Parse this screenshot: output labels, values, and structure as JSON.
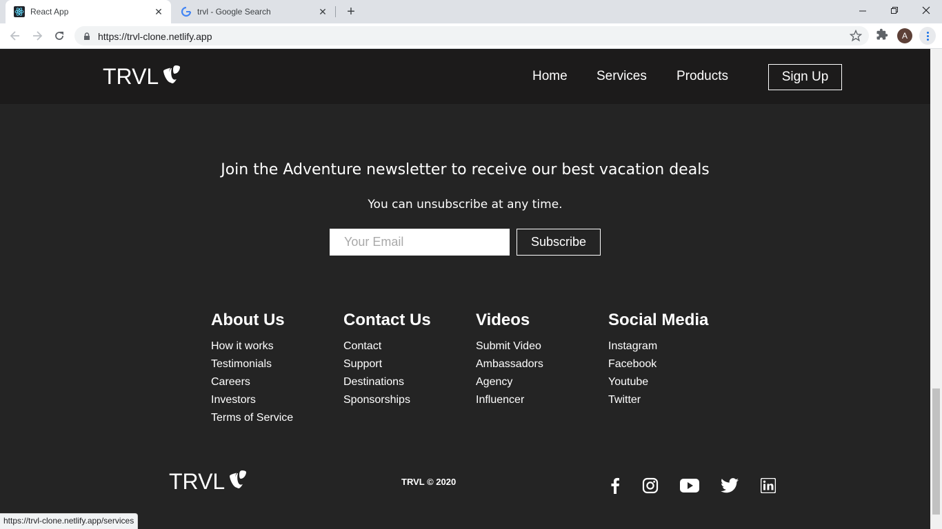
{
  "browser": {
    "tabs": [
      {
        "title": "React App",
        "favicon": "react-icon"
      },
      {
        "title": "trvl - Google Search",
        "favicon": "google-icon"
      }
    ],
    "url": "https://trvl-clone.netlify.app",
    "status_url": "https://trvl-clone.netlify.app/services",
    "profile_initial": "A"
  },
  "navbar": {
    "logo": "TRVL",
    "links": [
      "Home",
      "Services",
      "Products"
    ],
    "signup": "Sign Up"
  },
  "newsletter": {
    "heading": "Join the Adventure newsletter to receive our best vacation deals",
    "subheading": "You can unsubscribe at any time.",
    "email_placeholder": "Your Email",
    "subscribe": "Subscribe"
  },
  "footer_columns": [
    {
      "title": "About Us",
      "links": [
        "How it works",
        "Testimonials",
        "Careers",
        "Investors",
        "Terms of Service"
      ]
    },
    {
      "title": "Contact Us",
      "links": [
        "Contact",
        "Support",
        "Destinations",
        "Sponsorships"
      ]
    },
    {
      "title": "Videos",
      "links": [
        "Submit Video",
        "Ambassadors",
        "Agency",
        "Influencer"
      ]
    },
    {
      "title": "Social Media",
      "links": [
        "Instagram",
        "Facebook",
        "Youtube",
        "Twitter"
      ]
    }
  ],
  "footer": {
    "logo": "TRVL",
    "copyright": "TRVL © 2020",
    "social_icons": [
      "facebook-icon",
      "instagram-icon",
      "youtube-icon",
      "twitter-icon",
      "linkedin-icon"
    ]
  },
  "colors": {
    "page_bg": "#242424",
    "navbar_bg": "#1c1b1b",
    "text": "#ffffff"
  }
}
